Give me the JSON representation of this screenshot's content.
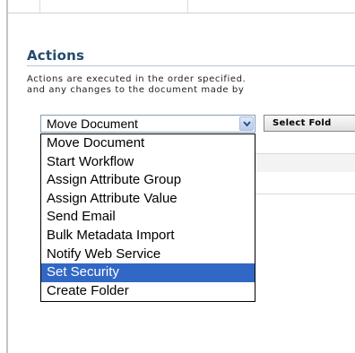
{
  "actions": {
    "title": "Actions",
    "description_line1": "Actions are executed in the order specified.",
    "description_line2": "and any changes to the document made by"
  },
  "action_select": {
    "selected_value": "Move Document",
    "options": [
      "Move Document",
      "Start Workflow",
      "Assign Attribute Group",
      "Assign Attribute Value",
      "Send Email",
      "Bulk Metadata Import",
      "Notify Web Service",
      "Set Security",
      "Create Folder"
    ],
    "highlighted_option": "Set Security"
  },
  "select_folder_button": {
    "label": "Select Fold"
  },
  "icons": {
    "dropdown_arrow": "chevron-down-icon"
  },
  "colors": {
    "title": "#244a6e",
    "highlight": "#3168c6",
    "select_border": "#7f9db9"
  }
}
